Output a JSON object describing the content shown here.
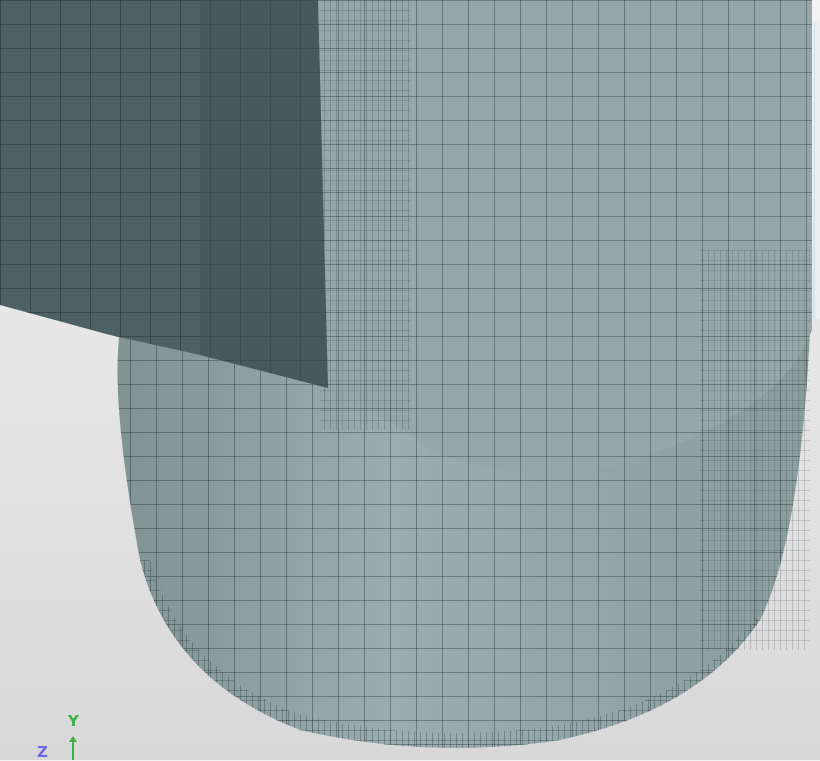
{
  "viewport": {
    "title": "Mesh view"
  },
  "axis_triad": {
    "y_label": "Y",
    "z_label": "Z",
    "y_color": "#3cb043",
    "z_color": "#6a6ae0"
  },
  "colors": {
    "mesh_surface": "#8fa3a5",
    "mesh_dark": "#4d6164",
    "mesh_lines": "#1e2a2c"
  }
}
